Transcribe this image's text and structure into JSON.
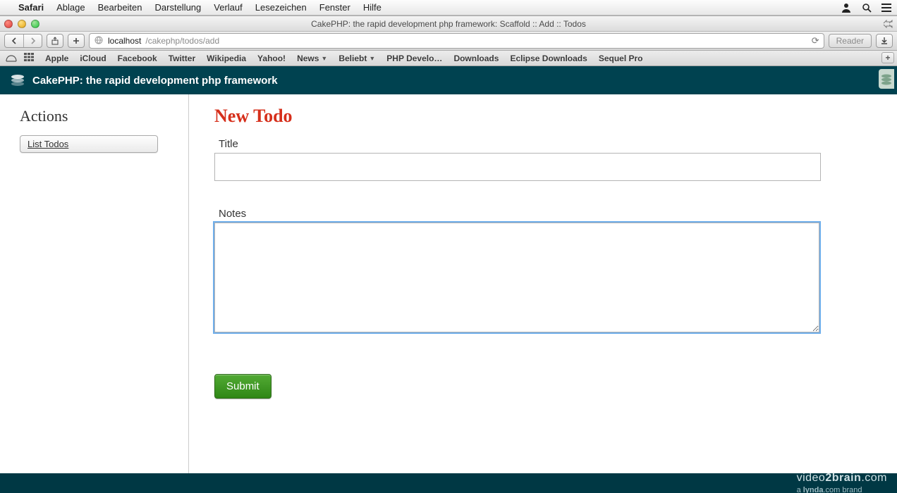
{
  "menubar": {
    "app_name": "Safari",
    "items": [
      "Ablage",
      "Bearbeiten",
      "Darstellung",
      "Verlauf",
      "Lesezeichen",
      "Fenster",
      "Hilfe"
    ]
  },
  "window": {
    "title": "CakePHP: the rapid development php framework: Scaffold :: Add :: Todos"
  },
  "address": {
    "host": "localhost",
    "path": "/cakephp/todos/add",
    "reader_label": "Reader"
  },
  "bookmarks": {
    "items": [
      {
        "label": "Apple",
        "dd": false
      },
      {
        "label": "iCloud",
        "dd": false
      },
      {
        "label": "Facebook",
        "dd": false
      },
      {
        "label": "Twitter",
        "dd": false
      },
      {
        "label": "Wikipedia",
        "dd": false
      },
      {
        "label": "Yahoo!",
        "dd": false
      },
      {
        "label": "News",
        "dd": true
      },
      {
        "label": "Beliebt",
        "dd": true
      },
      {
        "label": "PHP Develo…",
        "dd": false
      },
      {
        "label": "Downloads",
        "dd": false
      },
      {
        "label": "Eclipse Downloads",
        "dd": false
      },
      {
        "label": "Sequel Pro",
        "dd": false
      }
    ]
  },
  "cake_header": {
    "title": "CakePHP: the rapid development php framework"
  },
  "sidebar": {
    "heading": "Actions",
    "list_todos": "List Todos"
  },
  "form": {
    "heading": "New Todo",
    "title_label": "Title",
    "title_value": "",
    "notes_label": "Notes",
    "notes_value": "",
    "submit_label": "Submit"
  },
  "footer": {
    "brand_a": "video",
    "brand_b": "2brain",
    "brand_c": ".com",
    "sub_a": "a ",
    "sub_b": "lynda",
    "sub_c": ".com brand"
  }
}
